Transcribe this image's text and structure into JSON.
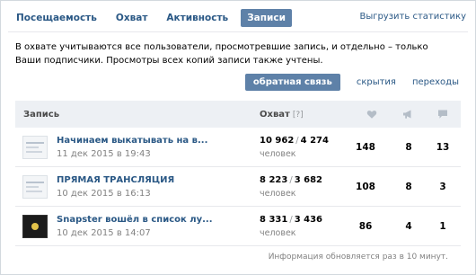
{
  "tabs": [
    {
      "label": "Посещаемость",
      "active": false
    },
    {
      "label": "Охват",
      "active": false
    },
    {
      "label": "Активность",
      "active": false
    },
    {
      "label": "Записи",
      "active": true
    }
  ],
  "export_link": "Выгрузить статистику",
  "info_text": "В охвате учитываются все пользователи, просмотревшие запись, и отдельно – только Ваши подписчики. Просмотры всех копий записи также учтены.",
  "filters": [
    {
      "label": "обратная связь",
      "active": true
    },
    {
      "label": "скрытия",
      "active": false
    },
    {
      "label": "переходы",
      "active": false
    }
  ],
  "table": {
    "header_post": "Запись",
    "header_reach": "Охват",
    "header_reach_hint": "[?]",
    "header_icons": [
      "heart-icon",
      "megaphone-icon",
      "comment-icon"
    ],
    "rows": [
      {
        "title": "Начинаем выкатывать на в...",
        "date": "11 дек 2015 в 19:43",
        "reach_total": "10 962",
        "reach_subs": "4 274",
        "people": "человек",
        "likes": "148",
        "shares": "8",
        "comments": "13"
      },
      {
        "title": "ПРЯМАЯ ТРАНСЛЯЦИЯ",
        "date": "10 дек 2015 в 16:13",
        "reach_total": "8 223",
        "reach_subs": "3 682",
        "people": "человек",
        "likes": "108",
        "shares": "8",
        "comments": "3"
      },
      {
        "title": "Snapster вошёл в список лу...",
        "date": "10 дек 2015 в 14:07",
        "reach_total": "8 331",
        "reach_subs": "3 436",
        "people": "человек",
        "likes": "86",
        "shares": "4",
        "comments": "1"
      }
    ]
  },
  "footer_note": "Информация обновляется раз в 10 минут.",
  "colors": {
    "accent": "#5e81a8",
    "link": "#2a5885",
    "header_bg": "#edf0f4",
    "icon": "#b4bdc7"
  }
}
